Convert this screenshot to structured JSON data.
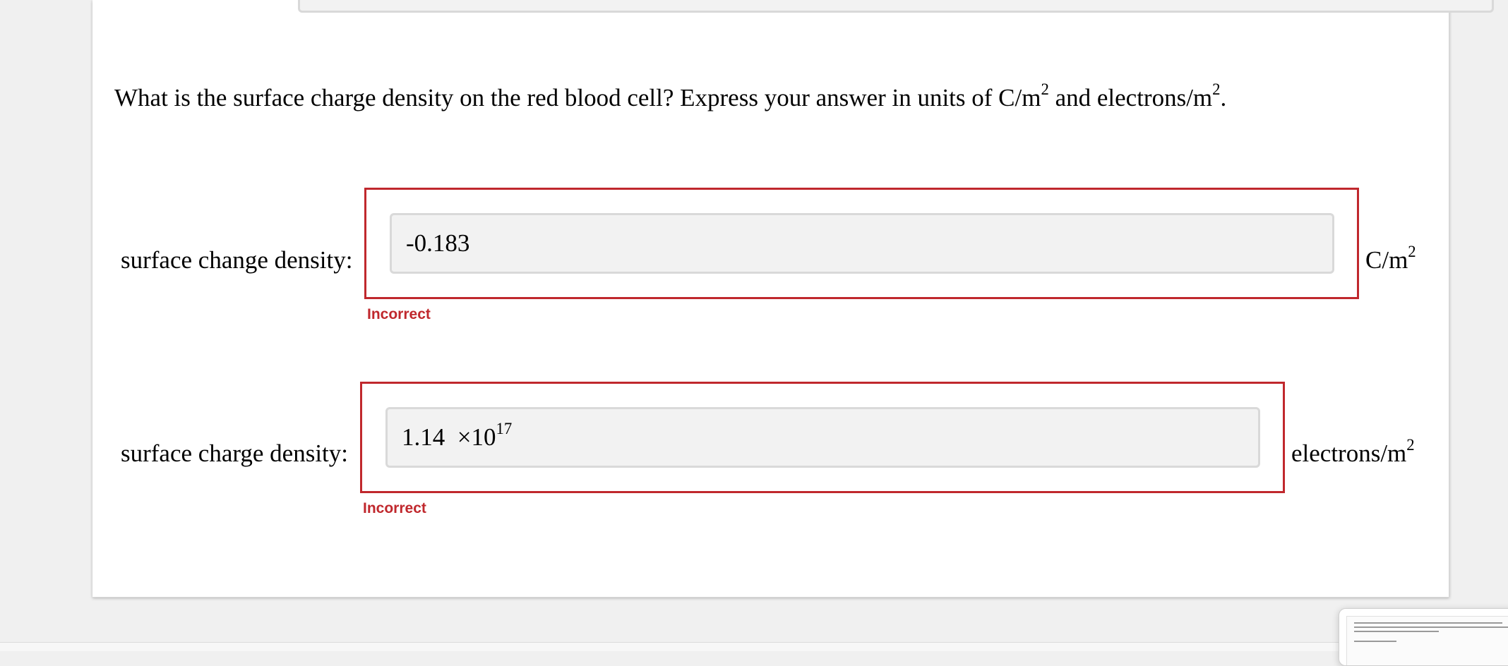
{
  "question": {
    "text": "What is the surface charge density on the red blood cell? Express your answer in units of C/m",
    "exp1": "2",
    "mid": " and electrons/m",
    "exp2": "2",
    "end": "."
  },
  "fields": [
    {
      "label": "surface change density:",
      "value": "-0.183",
      "unit_base": "C/m",
      "unit_exp": "2",
      "status": "Incorrect"
    },
    {
      "label": "surface charge density:",
      "mantissa": "1.14",
      "times_ten": "×10",
      "exponent": "17",
      "unit_base": "electrons/m",
      "unit_exp": "2",
      "status": "Incorrect"
    }
  ],
  "colors": {
    "incorrect": "#c0282d",
    "input_bg": "#f2f2f2",
    "input_border": "#d9d9d9"
  }
}
